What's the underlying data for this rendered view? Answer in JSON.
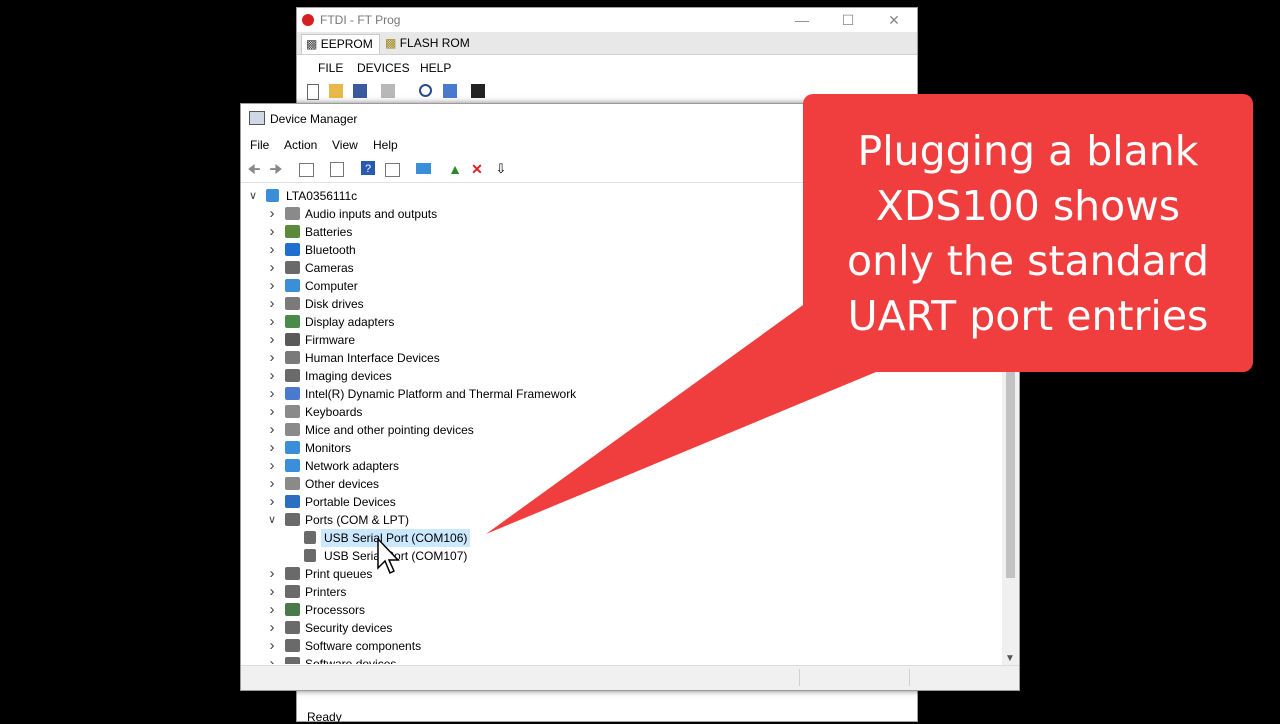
{
  "ftdi": {
    "title": "FTDI - FT Prog",
    "tabs": [
      "EEPROM",
      "FLASH ROM"
    ],
    "menu": [
      "FILE",
      "DEVICES",
      "HELP"
    ],
    "status": "Ready"
  },
  "device_manager": {
    "title": "Device Manager",
    "menu": [
      "File",
      "Action",
      "View",
      "Help"
    ],
    "root": "LTA0356111c",
    "categories": [
      {
        "label": "Audio inputs and outputs",
        "icon": "speaker-icon",
        "color": "#8a8a8a"
      },
      {
        "label": "Batteries",
        "icon": "battery-icon",
        "color": "#5a8a3a"
      },
      {
        "label": "Bluetooth",
        "icon": "bluetooth-icon",
        "color": "#1f6fd1"
      },
      {
        "label": "Cameras",
        "icon": "camera-icon",
        "color": "#6a6a6a"
      },
      {
        "label": "Computer",
        "icon": "computer-icon",
        "color": "#3a8fd8"
      },
      {
        "label": "Disk drives",
        "icon": "disk-drive-icon",
        "color": "#7a7a7a"
      },
      {
        "label": "Display adapters",
        "icon": "display-adapter-icon",
        "color": "#4a8a4a"
      },
      {
        "label": "Firmware",
        "icon": "firmware-icon",
        "color": "#5a5a5a"
      },
      {
        "label": "Human Interface Devices",
        "icon": "hid-icon",
        "color": "#7a7a7a"
      },
      {
        "label": "Imaging devices",
        "icon": "imaging-icon",
        "color": "#6a6a6a"
      },
      {
        "label": "Intel(R) Dynamic Platform and Thermal Framework",
        "icon": "intel-icon",
        "color": "#4a7ad0"
      },
      {
        "label": "Keyboards",
        "icon": "keyboard-icon",
        "color": "#8a8a8a"
      },
      {
        "label": "Mice and other pointing devices",
        "icon": "mouse-icon",
        "color": "#8a8a8a"
      },
      {
        "label": "Monitors",
        "icon": "monitor-icon",
        "color": "#3a8fd8"
      },
      {
        "label": "Network adapters",
        "icon": "network-adapter-icon",
        "color": "#3a8fd8"
      },
      {
        "label": "Other devices",
        "icon": "other-devices-icon",
        "color": "#8a8a8a"
      },
      {
        "label": "Portable Devices",
        "icon": "portable-device-icon",
        "color": "#2a6fc0"
      },
      {
        "label": "Ports (COM & LPT)",
        "icon": "port-icon",
        "color": "#6a6a6a",
        "expanded": true,
        "children": [
          "USB Serial Port (COM106)",
          "USB Serial Port (COM107)"
        ]
      },
      {
        "label": "Print queues",
        "icon": "print-queue-icon",
        "color": "#6a6a6a"
      },
      {
        "label": "Printers",
        "icon": "printer-icon",
        "color": "#6a6a6a"
      },
      {
        "label": "Processors",
        "icon": "processor-icon",
        "color": "#4a7a4a"
      },
      {
        "label": "Security devices",
        "icon": "security-device-icon",
        "color": "#6a6a6a"
      },
      {
        "label": "Software components",
        "icon": "software-component-icon",
        "color": "#6a6a6a"
      },
      {
        "label": "Software devices",
        "icon": "software-device-icon",
        "color": "#6a6a6a"
      }
    ]
  },
  "callout": {
    "lines": [
      "Plugging a blank",
      "XDS100 shows",
      "only the standard",
      "UART port entries"
    ],
    "color": "#f03e3e"
  }
}
